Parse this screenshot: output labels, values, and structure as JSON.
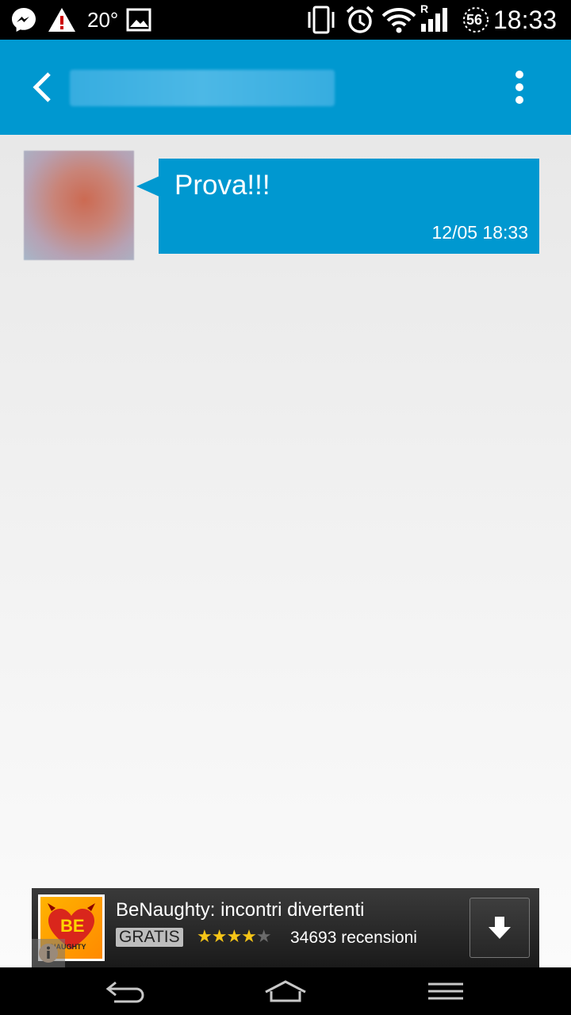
{
  "status_bar": {
    "temperature": "20°",
    "network_label": "R",
    "battery_level": "56",
    "time": "18:33",
    "icons": [
      "messenger-icon",
      "warning-icon",
      "image-icon",
      "vibrate-icon",
      "alarm-icon",
      "wifi-icon",
      "signal-icon",
      "battery-icon"
    ]
  },
  "app_bar": {
    "back_icon": "chevron-left-icon",
    "menu_icon": "overflow-menu-icon"
  },
  "messages": [
    {
      "text": "Prova!!!",
      "timestamp": "12/05 18:33"
    }
  ],
  "ad": {
    "title": "BeNaughty: incontri divertenti",
    "badge": "GRATIS",
    "rating": 4,
    "rating_max": 5,
    "reviews": "34693 recensioni",
    "logo_text_top": "BE",
    "logo_text_bottom": "NAUGHTY"
  },
  "nav_bar": {
    "icons": [
      "back-nav-icon",
      "home-nav-icon",
      "recents-nav-icon"
    ]
  },
  "colors": {
    "accent": "#0098d0",
    "chat_background": "#eeeeee"
  }
}
